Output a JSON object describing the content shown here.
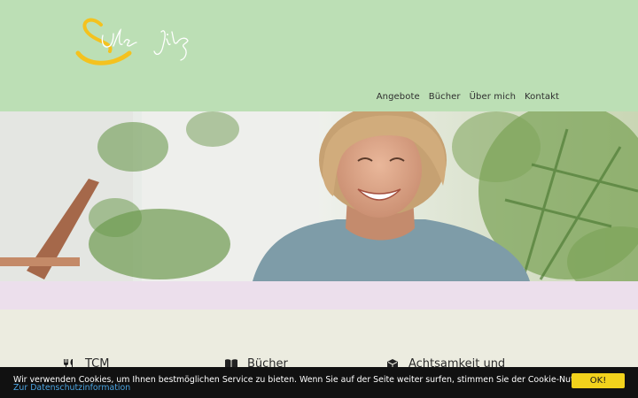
{
  "brand": {
    "logo_icon": "signature-logo",
    "logo_text": "Ulrike Jilg",
    "accent_color": "#f4c21e"
  },
  "nav": {
    "items": [
      {
        "label": "Angebote"
      },
      {
        "label": "Bücher"
      },
      {
        "label": "Über mich"
      },
      {
        "label": "Kontakt"
      }
    ]
  },
  "hero": {
    "image": "portrait-smiling-woman-garden"
  },
  "features": [
    {
      "icon": "cutlery-icon",
      "title": "TCM"
    },
    {
      "icon": "book-icon",
      "title": "Bücher"
    },
    {
      "icon": "cube-icon",
      "title": "Achtsamkeit und"
    }
  ],
  "cookie": {
    "message": "Wir verwenden Cookies, um Ihnen bestmöglichen Service zu bieten. Wenn Sie auf der Seite weiter surfen, stimmen Sie der Cookie-Nutzung zu.",
    "link_label": "Zur Datenschutzinformation",
    "ok_label": "OK!",
    "button_color": "#f2d21c"
  }
}
